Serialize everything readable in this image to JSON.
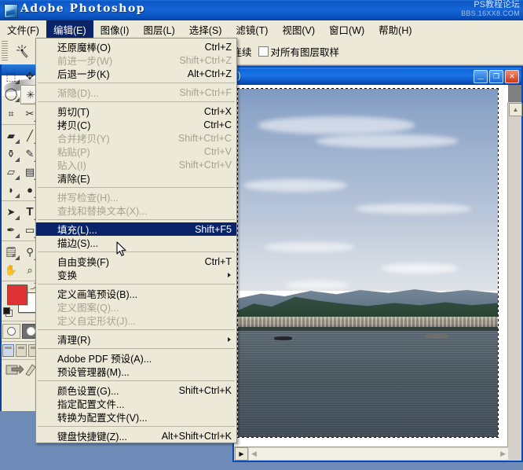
{
  "app": {
    "title": "Adobe Photoshop",
    "icon": "photoshop-logo-icon",
    "watermark_line1": "PS教程论坛",
    "watermark_line2": "BBS.16XX8.COM"
  },
  "menubar": {
    "items": [
      {
        "label": "文件(F)",
        "active": false
      },
      {
        "label": "编辑(E)",
        "active": true
      },
      {
        "label": "图像(I)",
        "active": false
      },
      {
        "label": "图层(L)",
        "active": false
      },
      {
        "label": "选择(S)",
        "active": false
      },
      {
        "label": "滤镜(T)",
        "active": false
      },
      {
        "label": "视图(V)",
        "active": false
      },
      {
        "label": "窗口(W)",
        "active": false
      },
      {
        "label": "帮助(H)",
        "active": false
      }
    ]
  },
  "options_bar": {
    "tool_icon": "magic-wand-icon",
    "dropdown_icon": "chevron-down-icon",
    "checkboxes": [
      {
        "label": "连续",
        "checked": true
      },
      {
        "label": "对所有图层取样",
        "checked": false
      }
    ]
  },
  "toolbox": {
    "tools": [
      {
        "name": "rectangular-marquee-tool",
        "glyph": "⬚",
        "selected": false
      },
      {
        "name": "move-tool",
        "glyph": "✥",
        "selected": false
      },
      {
        "name": "lasso-tool",
        "glyph": "◠",
        "selected": false
      },
      {
        "name": "magic-wand-tool",
        "glyph": "✳",
        "selected": true
      },
      {
        "name": "crop-tool",
        "glyph": "⌗",
        "selected": false
      },
      {
        "name": "slice-tool",
        "glyph": "✂",
        "selected": false
      },
      {
        "name": "healing-brush-tool",
        "glyph": "◣",
        "selected": false
      },
      {
        "name": "brush-tool",
        "glyph": "🖌",
        "selected": false
      },
      {
        "name": "clone-stamp-tool",
        "glyph": "⚱",
        "selected": false
      },
      {
        "name": "history-brush-tool",
        "glyph": "✎",
        "selected": false
      },
      {
        "name": "eraser-tool",
        "glyph": "▱",
        "selected": false
      },
      {
        "name": "gradient-tool",
        "glyph": "▤",
        "selected": false
      },
      {
        "name": "blur-tool",
        "glyph": "💧",
        "selected": false
      },
      {
        "name": "dodge-tool",
        "glyph": "🍳",
        "selected": false
      },
      {
        "name": "path-selection-tool",
        "glyph": "➤",
        "selected": false
      },
      {
        "name": "type-tool",
        "glyph": "T",
        "selected": false
      },
      {
        "name": "pen-tool",
        "glyph": "✒",
        "selected": false
      },
      {
        "name": "shape-tool",
        "glyph": "▭",
        "selected": false
      },
      {
        "name": "notes-tool",
        "glyph": "🗒",
        "selected": false
      },
      {
        "name": "eyedropper-tool",
        "glyph": "⚲",
        "selected": false
      },
      {
        "name": "hand-tool",
        "glyph": "✋",
        "selected": false
      },
      {
        "name": "zoom-tool",
        "glyph": "🔍",
        "selected": false
      }
    ],
    "colors": {
      "foreground": "#e03232",
      "background": "#ffffff",
      "swap_icon": "swap-colors-icon",
      "default_icon": "default-colors-icon"
    },
    "quickmask": [
      {
        "name": "standard-mode-button",
        "active": false
      },
      {
        "name": "quick-mask-mode-button",
        "active": true
      }
    ],
    "screen_modes": [
      {
        "name": "standard-screen-mode-button",
        "active": true
      },
      {
        "name": "full-screen-with-menubar-button",
        "active": false
      },
      {
        "name": "full-screen-mode-button",
        "active": false
      }
    ],
    "jump_to": {
      "name": "jump-to-imageready-icon"
    }
  },
  "document_window": {
    "title": ")",
    "buttons": [
      {
        "name": "minimize-button",
        "glyph": "_"
      },
      {
        "name": "maximize-button",
        "glyph": "❐"
      },
      {
        "name": "close-button",
        "glyph": "✕"
      }
    ],
    "image": {
      "description": "lake-landscape-photo",
      "has_selection": true
    },
    "scrollbars": {
      "vertical": {
        "up_glyph": "▲",
        "down_glyph": "▼"
      },
      "horizontal": {
        "left_glyph": "◄",
        "right_glyph": "►",
        "toggle_glyph": "▶"
      }
    }
  },
  "edit_menu": {
    "items": [
      {
        "label": "还原魔棒(O)",
        "accel": "Ctrl+Z",
        "disabled": false,
        "highlight": false,
        "submenu": false
      },
      {
        "label": "前进一步(W)",
        "accel": "Shift+Ctrl+Z",
        "disabled": true,
        "highlight": false,
        "submenu": false
      },
      {
        "label": "后退一步(K)",
        "accel": "Alt+Ctrl+Z",
        "disabled": false,
        "highlight": false,
        "submenu": false
      },
      {
        "separator": true
      },
      {
        "label": "渐隐(D)...",
        "accel": "Shift+Ctrl+F",
        "disabled": true,
        "highlight": false,
        "submenu": false
      },
      {
        "separator": true
      },
      {
        "label": "剪切(T)",
        "accel": "Ctrl+X",
        "disabled": false,
        "highlight": false,
        "submenu": false
      },
      {
        "label": "拷贝(C)",
        "accel": "Ctrl+C",
        "disabled": false,
        "highlight": false,
        "submenu": false
      },
      {
        "label": "合并拷贝(Y)",
        "accel": "Shift+Ctrl+C",
        "disabled": true,
        "highlight": false,
        "submenu": false
      },
      {
        "label": "粘贴(P)",
        "accel": "Ctrl+V",
        "disabled": true,
        "highlight": false,
        "submenu": false
      },
      {
        "label": "贴入(I)",
        "accel": "Shift+Ctrl+V",
        "disabled": true,
        "highlight": false,
        "submenu": false
      },
      {
        "label": "清除(E)",
        "accel": "",
        "disabled": false,
        "highlight": false,
        "submenu": false
      },
      {
        "separator": true
      },
      {
        "label": "拼写检查(H)...",
        "accel": "",
        "disabled": true,
        "highlight": false,
        "submenu": false
      },
      {
        "label": "查找和替换文本(X)...",
        "accel": "",
        "disabled": true,
        "highlight": false,
        "submenu": false
      },
      {
        "separator": true
      },
      {
        "label": "填充(L)...",
        "accel": "Shift+F5",
        "disabled": false,
        "highlight": true,
        "submenu": false
      },
      {
        "label": "描边(S)...",
        "accel": "",
        "disabled": false,
        "highlight": false,
        "submenu": false
      },
      {
        "separator": true
      },
      {
        "label": "自由变换(F)",
        "accel": "Ctrl+T",
        "disabled": false,
        "highlight": false,
        "submenu": false
      },
      {
        "label": "变换",
        "accel": "",
        "disabled": false,
        "highlight": false,
        "submenu": true
      },
      {
        "separator": true
      },
      {
        "label": "定义画笔预设(B)...",
        "accel": "",
        "disabled": false,
        "highlight": false,
        "submenu": false
      },
      {
        "label": "定义图案(Q)...",
        "accel": "",
        "disabled": true,
        "highlight": false,
        "submenu": false
      },
      {
        "label": "定义自定形状(J)...",
        "accel": "",
        "disabled": true,
        "highlight": false,
        "submenu": false
      },
      {
        "separator": true
      },
      {
        "label": "清理(R)",
        "accel": "",
        "disabled": false,
        "highlight": false,
        "submenu": true
      },
      {
        "separator": true
      },
      {
        "label": "Adobe PDF 预设(A)...",
        "accel": "",
        "disabled": false,
        "highlight": false,
        "submenu": false
      },
      {
        "label": "预设管理器(M)...",
        "accel": "",
        "disabled": false,
        "highlight": false,
        "submenu": false
      },
      {
        "separator": true
      },
      {
        "label": "颜色设置(G)...",
        "accel": "Shift+Ctrl+K",
        "disabled": false,
        "highlight": false,
        "submenu": false
      },
      {
        "label": "指定配置文件...",
        "accel": "",
        "disabled": false,
        "highlight": false,
        "submenu": false
      },
      {
        "label": "转换为配置文件(V)...",
        "accel": "",
        "disabled": false,
        "highlight": false,
        "submenu": false
      },
      {
        "separator": true
      },
      {
        "label": "键盘快捷键(Z)...",
        "accel": "Alt+Shift+Ctrl+K",
        "disabled": false,
        "highlight": false,
        "submenu": false
      }
    ]
  },
  "cursor": {
    "name": "mouse-pointer-cursor"
  }
}
